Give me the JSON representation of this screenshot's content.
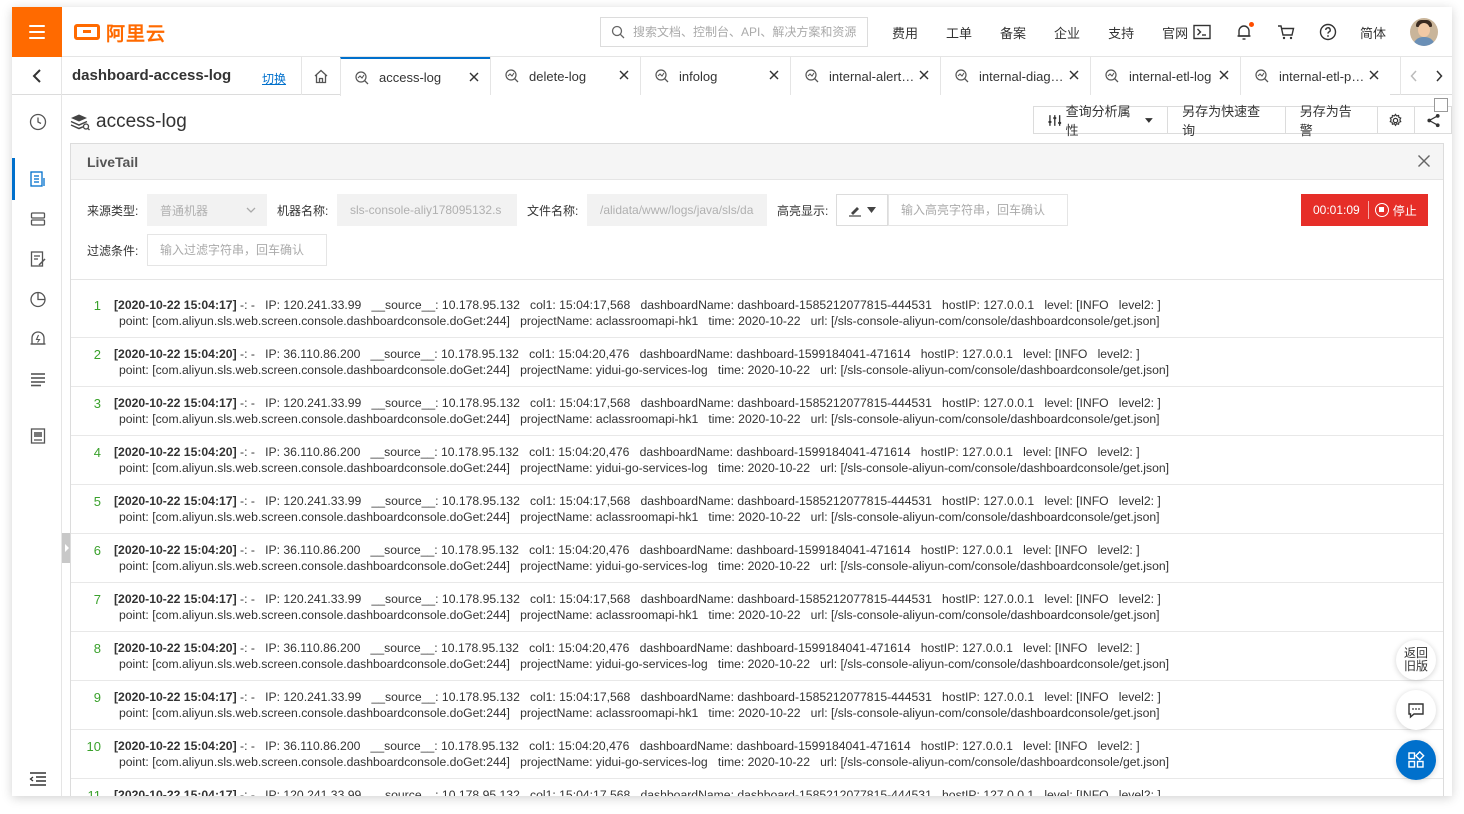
{
  "header": {
    "logo_text": "阿里云",
    "search_placeholder": "搜索文档、控制台、API、解决方案和资源",
    "nav": [
      "费用",
      "工单",
      "备案",
      "企业",
      "支持",
      "官网"
    ],
    "language": "简体"
  },
  "tabbar": {
    "project_name": "dashboard-access-log",
    "switch_label": "切换",
    "tabs": [
      {
        "label": "access-log",
        "active": true
      },
      {
        "label": "delete-log",
        "active": false
      },
      {
        "label": "infolog",
        "active": false
      },
      {
        "label": "internal-alert-…",
        "active": false
      },
      {
        "label": "internal-diag…",
        "active": false
      },
      {
        "label": "internal-etl-log",
        "active": false
      },
      {
        "label": "internal-etl-pr…",
        "active": false
      }
    ]
  },
  "main": {
    "logstore_title": "access-log",
    "toolbar": {
      "query_props": "查询分析属性",
      "save_quick_query": "另存为快速查询",
      "save_alert": "另存为告警"
    }
  },
  "livetail": {
    "title": "LiveTail",
    "source_type_label": "来源类型:",
    "source_type_value": "普通机器",
    "machine_label": "机器名称:",
    "machine_value": "sls-console-aliy178095132.s",
    "file_label": "文件名称:",
    "file_value": "/alidata/www/logs/java/sls/da",
    "highlight_label": "高亮显示:",
    "highlight_placeholder": "输入高亮字符串，回车确认",
    "filter_label": "过滤条件:",
    "filter_placeholder": "输入过滤字符串，回车确认",
    "timer": "00:01:09",
    "stop_label": "停止"
  },
  "logs": [
    {
      "num": "1",
      "time": "[2020-10-22 15:04:17]",
      "line1": " -: -   IP: 120.241.33.99   __source__: 10.178.95.132   col1: 15:04:17,568   dashboardName: dashboard-1585212077815-444531   hostIP: 127.0.0.1   level: [INFO   level2: ]",
      "line2": "point: [com.aliyun.sls.web.screen.console.dashboardconsole.doGet:244]   projectName: aclassroomapi-hk1   time: 2020-10-22   url: [/sls-console-aliyun-com/console/dashboardconsole/get.json]"
    },
    {
      "num": "2",
      "time": "[2020-10-22 15:04:20]",
      "line1": " -: -   IP: 36.110.86.200   __source__: 10.178.95.132   col1: 15:04:20,476   dashboardName: dashboard-1599184041-471614   hostIP: 127.0.0.1   level: [INFO   level2: ]",
      "line2": "point: [com.aliyun.sls.web.screen.console.dashboardconsole.doGet:244]   projectName: yidui-go-services-log   time: 2020-10-22   url: [/sls-console-aliyun-com/console/dashboardconsole/get.json]"
    },
    {
      "num": "3",
      "time": "[2020-10-22 15:04:17]",
      "line1": " -: -   IP: 120.241.33.99   __source__: 10.178.95.132   col1: 15:04:17,568   dashboardName: dashboard-1585212077815-444531   hostIP: 127.0.0.1   level: [INFO   level2: ]",
      "line2": "point: [com.aliyun.sls.web.screen.console.dashboardconsole.doGet:244]   projectName: aclassroomapi-hk1   time: 2020-10-22   url: [/sls-console-aliyun-com/console/dashboardconsole/get.json]"
    },
    {
      "num": "4",
      "time": "[2020-10-22 15:04:20]",
      "line1": " -: -   IP: 36.110.86.200   __source__: 10.178.95.132   col1: 15:04:20,476   dashboardName: dashboard-1599184041-471614   hostIP: 127.0.0.1   level: [INFO   level2: ]",
      "line2": "point: [com.aliyun.sls.web.screen.console.dashboardconsole.doGet:244]   projectName: yidui-go-services-log   time: 2020-10-22   url: [/sls-console-aliyun-com/console/dashboardconsole/get.json]"
    },
    {
      "num": "5",
      "time": "[2020-10-22 15:04:17]",
      "line1": " -: -   IP: 120.241.33.99   __source__: 10.178.95.132   col1: 15:04:17,568   dashboardName: dashboard-1585212077815-444531   hostIP: 127.0.0.1   level: [INFO   level2: ]",
      "line2": "point: [com.aliyun.sls.web.screen.console.dashboardconsole.doGet:244]   projectName: aclassroomapi-hk1   time: 2020-10-22   url: [/sls-console-aliyun-com/console/dashboardconsole/get.json]"
    },
    {
      "num": "6",
      "time": "[2020-10-22 15:04:20]",
      "line1": " -: -   IP: 36.110.86.200   __source__: 10.178.95.132   col1: 15:04:20,476   dashboardName: dashboard-1599184041-471614   hostIP: 127.0.0.1   level: [INFO   level2: ]",
      "line2": "point: [com.aliyun.sls.web.screen.console.dashboardconsole.doGet:244]   projectName: yidui-go-services-log   time: 2020-10-22   url: [/sls-console-aliyun-com/console/dashboardconsole/get.json]"
    },
    {
      "num": "7",
      "time": "[2020-10-22 15:04:17]",
      "line1": " -: -   IP: 120.241.33.99   __source__: 10.178.95.132   col1: 15:04:17,568   dashboardName: dashboard-1585212077815-444531   hostIP: 127.0.0.1   level: [INFO   level2: ]",
      "line2": "point: [com.aliyun.sls.web.screen.console.dashboardconsole.doGet:244]   projectName: aclassroomapi-hk1   time: 2020-10-22   url: [/sls-console-aliyun-com/console/dashboardconsole/get.json]"
    },
    {
      "num": "8",
      "time": "[2020-10-22 15:04:20]",
      "line1": " -: -   IP: 36.110.86.200   __source__: 10.178.95.132   col1: 15:04:20,476   dashboardName: dashboard-1599184041-471614   hostIP: 127.0.0.1   level: [INFO   level2: ]",
      "line2": "point: [com.aliyun.sls.web.screen.console.dashboardconsole.doGet:244]   projectName: yidui-go-services-log   time: 2020-10-22   url: [/sls-console-aliyun-com/console/dashboardconsole/get.json]"
    },
    {
      "num": "9",
      "time": "[2020-10-22 15:04:17]",
      "line1": " -: -   IP: 120.241.33.99   __source__: 10.178.95.132   col1: 15:04:17,568   dashboardName: dashboard-1585212077815-444531   hostIP: 127.0.0.1   level: [INFO   level2: ]",
      "line2": "point: [com.aliyun.sls.web.screen.console.dashboardconsole.doGet:244]   projectName: aclassroomapi-hk1   time: 2020-10-22   url: [/sls-console-aliyun-com/console/dashboardconsole/get.json]"
    },
    {
      "num": "10",
      "time": "[2020-10-22 15:04:20]",
      "line1": " -: -   IP: 36.110.86.200   __source__: 10.178.95.132   col1: 15:04:20,476   dashboardName: dashboard-1599184041-471614   hostIP: 127.0.0.1   level: [INFO   level2: ]",
      "line2": "point: [com.aliyun.sls.web.screen.console.dashboardconsole.doGet:244]   projectName: yidui-go-services-log   time: 2020-10-22   url: [/sls-console-aliyun-com/console/dashboardconsole/get.json]"
    },
    {
      "num": "11",
      "time": "[2020-10-22 15:04:17]",
      "line1": " -: -   IP: 120.241.33.99   __source__: 10.178.95.132   col1: 15:04:17,568   dashboardName: dashboard-1585212077815-444531   hostIP: 127.0.0.1   level: [INFO   level2: ]",
      "line2": ""
    }
  ],
  "floating": {
    "back_old": "返回旧版"
  },
  "colors": {
    "brand_orange": "#ff6a00",
    "primary_blue": "#0070cc",
    "stop_red": "#e62e28",
    "line_number_green": "#3aa12c"
  }
}
